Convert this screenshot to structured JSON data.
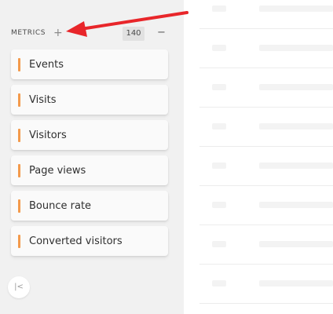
{
  "sidebar": {
    "title": "METRICS",
    "add_icon": "+",
    "count": "140",
    "collapse_icon": "−",
    "toggle_icon": "|<",
    "accent_color": "#f39a4c",
    "items": [
      {
        "label": "Events"
      },
      {
        "label": "Visits"
      },
      {
        "label": "Visitors"
      },
      {
        "label": "Page views"
      },
      {
        "label": "Bounce rate"
      },
      {
        "label": "Converted visitors"
      }
    ]
  },
  "annotation": {
    "arrow_color": "#e8262a"
  }
}
